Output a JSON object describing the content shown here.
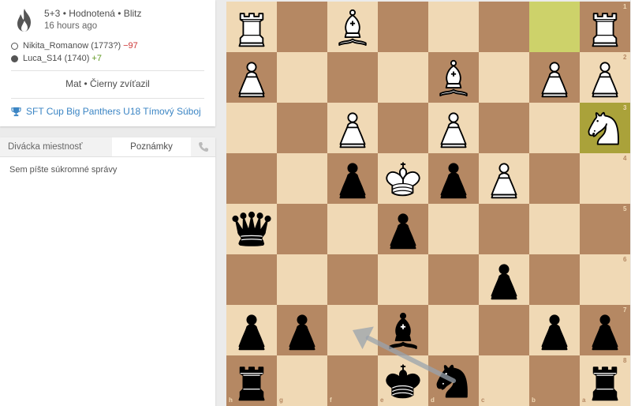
{
  "game": {
    "title": "5+3 • Hodnotená • Blitz",
    "ago": "16 hours ago",
    "players": [
      {
        "color": "white",
        "name": "Nikita_Romanow (1773?)",
        "diff": "−97",
        "diff_type": "neg"
      },
      {
        "color": "black",
        "name": "Luca_S14 (1740)",
        "diff": "+7",
        "diff_type": "pos"
      }
    ],
    "result": "Mat • Čierny zvíťazil",
    "tournament": "SFT Cup Big Panthers U18 Tímový Súboj"
  },
  "chat": {
    "tab_room": "Divácka miestnosť",
    "tab_notes": "Poznámky",
    "notes_placeholder": "Sem píšte súkromné správy"
  },
  "board": {
    "orientation": "black",
    "rank_labels": [
      "1",
      "2",
      "3",
      "4",
      "5",
      "6",
      "7",
      "8"
    ],
    "file_labels": [
      "h",
      "g",
      "f",
      "e",
      "d",
      "c",
      "b",
      "a"
    ],
    "highlights": [
      [
        0,
        6
      ],
      [
        2,
        7
      ]
    ],
    "pieces": [
      {
        "r": 0,
        "c": 0,
        "t": "R",
        "w": true
      },
      {
        "r": 0,
        "c": 2,
        "t": "B",
        "w": true
      },
      {
        "r": 0,
        "c": 7,
        "t": "R",
        "w": true
      },
      {
        "r": 1,
        "c": 0,
        "t": "P",
        "w": true
      },
      {
        "r": 1,
        "c": 4,
        "t": "B",
        "w": true
      },
      {
        "r": 1,
        "c": 6,
        "t": "P",
        "w": true
      },
      {
        "r": 1,
        "c": 7,
        "t": "P",
        "w": true
      },
      {
        "r": 2,
        "c": 2,
        "t": "P",
        "w": true
      },
      {
        "r": 2,
        "c": 4,
        "t": "P",
        "w": true
      },
      {
        "r": 2,
        "c": 7,
        "t": "N",
        "w": true
      },
      {
        "r": 3,
        "c": 2,
        "t": "P",
        "w": false
      },
      {
        "r": 3,
        "c": 3,
        "t": "K",
        "w": true
      },
      {
        "r": 3,
        "c": 4,
        "t": "P",
        "w": false
      },
      {
        "r": 3,
        "c": 5,
        "t": "P",
        "w": true
      },
      {
        "r": 4,
        "c": 0,
        "t": "Q",
        "w": false
      },
      {
        "r": 4,
        "c": 3,
        "t": "P",
        "w": false
      },
      {
        "r": 5,
        "c": 5,
        "t": "P",
        "w": false
      },
      {
        "r": 6,
        "c": 0,
        "t": "P",
        "w": false
      },
      {
        "r": 6,
        "c": 1,
        "t": "P",
        "w": false
      },
      {
        "r": 6,
        "c": 3,
        "t": "B",
        "w": false
      },
      {
        "r": 6,
        "c": 6,
        "t": "P",
        "w": false
      },
      {
        "r": 6,
        "c": 7,
        "t": "P",
        "w": false
      },
      {
        "r": 7,
        "c": 0,
        "t": "R",
        "w": false
      },
      {
        "r": 7,
        "c": 3,
        "t": "K",
        "w": false
      },
      {
        "r": 7,
        "c": 4,
        "t": "N",
        "w": false
      },
      {
        "r": 7,
        "c": 7,
        "t": "R",
        "w": false
      }
    ],
    "arrow": {
      "from": [
        7,
        4
      ],
      "to": [
        6,
        2
      ],
      "color": "#9aa3ad"
    }
  }
}
